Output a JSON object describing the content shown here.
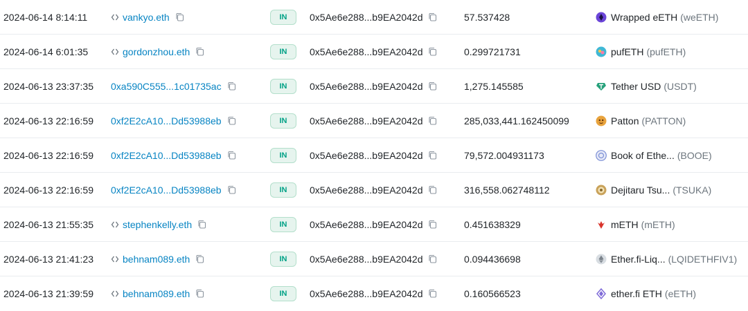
{
  "rows": [
    {
      "time": "2024-06-14 8:14:11",
      "from": "vankyo.eth",
      "from_is_ens": true,
      "direction": "IN",
      "to": "0x5Ae6e288...b9EA2042d",
      "amount": "57.537428",
      "token_name": "Wrapped eETH",
      "token_symbol": "(weETH)",
      "token_icon": "weeth-icon",
      "token_color": "#6b45d8"
    },
    {
      "time": "2024-06-14 6:01:35",
      "from": "gordonzhou.eth",
      "from_is_ens": true,
      "direction": "IN",
      "to": "0x5Ae6e288...b9EA2042d",
      "amount": "0.299721731",
      "token_name": "pufETH",
      "token_symbol": "(pufETH)",
      "token_icon": "pufeth-icon",
      "token_color": "#3fb8d6"
    },
    {
      "time": "2024-06-13 23:37:35",
      "from": "0xa590C555...1c01735ac",
      "from_is_ens": false,
      "direction": "IN",
      "to": "0x5Ae6e288...b9EA2042d",
      "amount": "1,275.145585",
      "token_name": "Tether USD",
      "token_symbol": "(USDT)",
      "token_icon": "usdt-icon",
      "token_color": "#26a17b"
    },
    {
      "time": "2024-06-13 22:16:59",
      "from": "0xf2E2cA10...Dd53988eb",
      "from_is_ens": false,
      "direction": "IN",
      "to": "0x5Ae6e288...b9EA2042d",
      "amount": "285,033,441.162450099",
      "token_name": "Patton",
      "token_symbol": "(PATTON)",
      "token_icon": "patton-icon",
      "token_color": "#e8a33d"
    },
    {
      "time": "2024-06-13 22:16:59",
      "from": "0xf2E2cA10...Dd53988eb",
      "from_is_ens": false,
      "direction": "IN",
      "to": "0x5Ae6e288...b9EA2042d",
      "amount": "79,572.004931173",
      "token_name": "Book of Ethe...",
      "token_symbol": "(BOOE)",
      "token_icon": "booe-icon",
      "token_color": "#7b8fd6"
    },
    {
      "time": "2024-06-13 22:16:59",
      "from": "0xf2E2cA10...Dd53988eb",
      "from_is_ens": false,
      "direction": "IN",
      "to": "0x5Ae6e288...b9EA2042d",
      "amount": "316,558.062748112",
      "token_name": "Dejitaru Tsu...",
      "token_symbol": "(TSUKA)",
      "token_icon": "tsuka-icon",
      "token_color": "#c9a25a"
    },
    {
      "time": "2024-06-13 21:55:35",
      "from": "stephenkelly.eth",
      "from_is_ens": true,
      "direction": "IN",
      "to": "0x5Ae6e288...b9EA2042d",
      "amount": "0.451638329",
      "token_name": "mETH",
      "token_symbol": "(mETH)",
      "token_icon": "meth-icon",
      "token_color": "#d9342b"
    },
    {
      "time": "2024-06-13 21:41:23",
      "from": "behnam089.eth",
      "from_is_ens": true,
      "direction": "IN",
      "to": "0x5Ae6e288...b9EA2042d",
      "amount": "0.094436698",
      "token_name": "Ether.fi-Liq...",
      "token_symbol": "(LQIDETHFIV1)",
      "token_icon": "ether-icon",
      "token_color": "#a0a6ad"
    },
    {
      "time": "2024-06-13 21:39:59",
      "from": "behnam089.eth",
      "from_is_ens": true,
      "direction": "IN",
      "to": "0x5Ae6e288...b9EA2042d",
      "amount": "0.160566523",
      "token_name": "ether.fi ETH",
      "token_symbol": "(eETH)",
      "token_icon": "eeth-icon",
      "token_color": "#7f6bd8"
    }
  ]
}
